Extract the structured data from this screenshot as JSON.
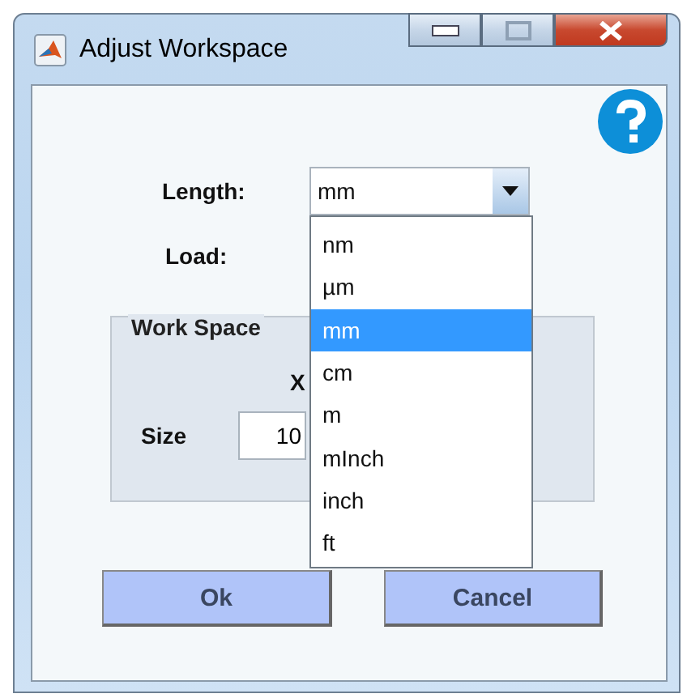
{
  "window": {
    "title": "Adjust Workspace"
  },
  "length": {
    "label": "Length:",
    "value": "mm",
    "expanded": true,
    "options": [
      {
        "label": "nm",
        "selected": false
      },
      {
        "label": "µm",
        "selected": false
      },
      {
        "label": "mm",
        "selected": true
      },
      {
        "label": "cm",
        "selected": false
      },
      {
        "label": "m",
        "selected": false
      },
      {
        "label": "mInch",
        "selected": false
      },
      {
        "label": "inch",
        "selected": false
      },
      {
        "label": "ft",
        "selected": false
      }
    ]
  },
  "load": {
    "label": "Load:"
  },
  "work_space": {
    "title": "Work Space",
    "column_header": "X",
    "size_label": "Size",
    "size_value": "10"
  },
  "buttons": [
    "Ok",
    "Cancel"
  ]
}
